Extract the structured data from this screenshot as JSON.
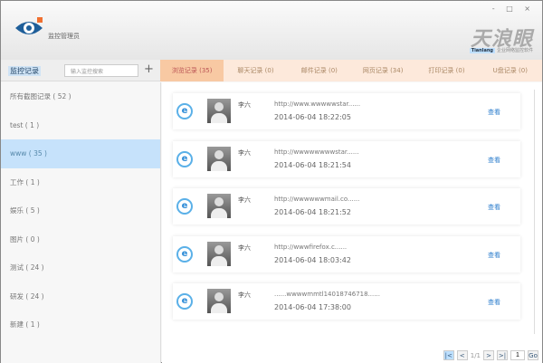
{
  "app": {
    "title": "监控管理员",
    "brand": "天浪眼",
    "brand_tag": "Tianlang",
    "brand_sub": "企业网络监控软件",
    "window_controls": "- □ ×"
  },
  "toolbar": {
    "title": "监控记录",
    "search_placeholder": "输入监控搜索",
    "add": "+"
  },
  "tabs": [
    {
      "label": "浏览记录 (35)",
      "active": true
    },
    {
      "label": "聊天记录 (0)"
    },
    {
      "label": "邮件记录 (0)"
    },
    {
      "label": "网页记录 (34)"
    },
    {
      "label": "打印记录 (0)"
    },
    {
      "label": "U盘记录 (0)"
    }
  ],
  "categories": [
    {
      "label": "所有截图记录 ( 52 )"
    },
    {
      "label": "test ( 1 )"
    },
    {
      "label": "www ( 35 )",
      "active": true
    },
    {
      "label": "工作 ( 1 )"
    },
    {
      "label": "娱乐 ( 5 )"
    },
    {
      "label": "图片 ( 0 )"
    },
    {
      "label": "测试 ( 24 )"
    },
    {
      "label": "研发 ( 24 )"
    },
    {
      "label": "新建 ( 1 )"
    }
  ],
  "records": [
    {
      "name": "李六",
      "url": "http://www.wwwwwstar......",
      "time": "2014-06-04 18:22:05",
      "action": "查看"
    },
    {
      "name": "李六",
      "url": "http://wwwwwwwwstar......",
      "time": "2014-06-04 18:21:54",
      "action": "查看"
    },
    {
      "name": "李六",
      "url": "http://wwwwwwmail.co......",
      "time": "2014-06-04 18:21:52",
      "action": "查看"
    },
    {
      "name": "李六",
      "url": "http://wwwfirefox.c......",
      "time": "2014-06-04 18:03:42",
      "action": "查看"
    },
    {
      "name": "李六",
      "url": "......wwwwmmtl14018746718......",
      "time": "2014-06-04 17:38:00",
      "action": "查看"
    }
  ],
  "pager": {
    "first": "|<",
    "prev": "<",
    "page": "1/1",
    "next": ">",
    "last": ">|",
    "input": "1",
    "go": "Go"
  }
}
